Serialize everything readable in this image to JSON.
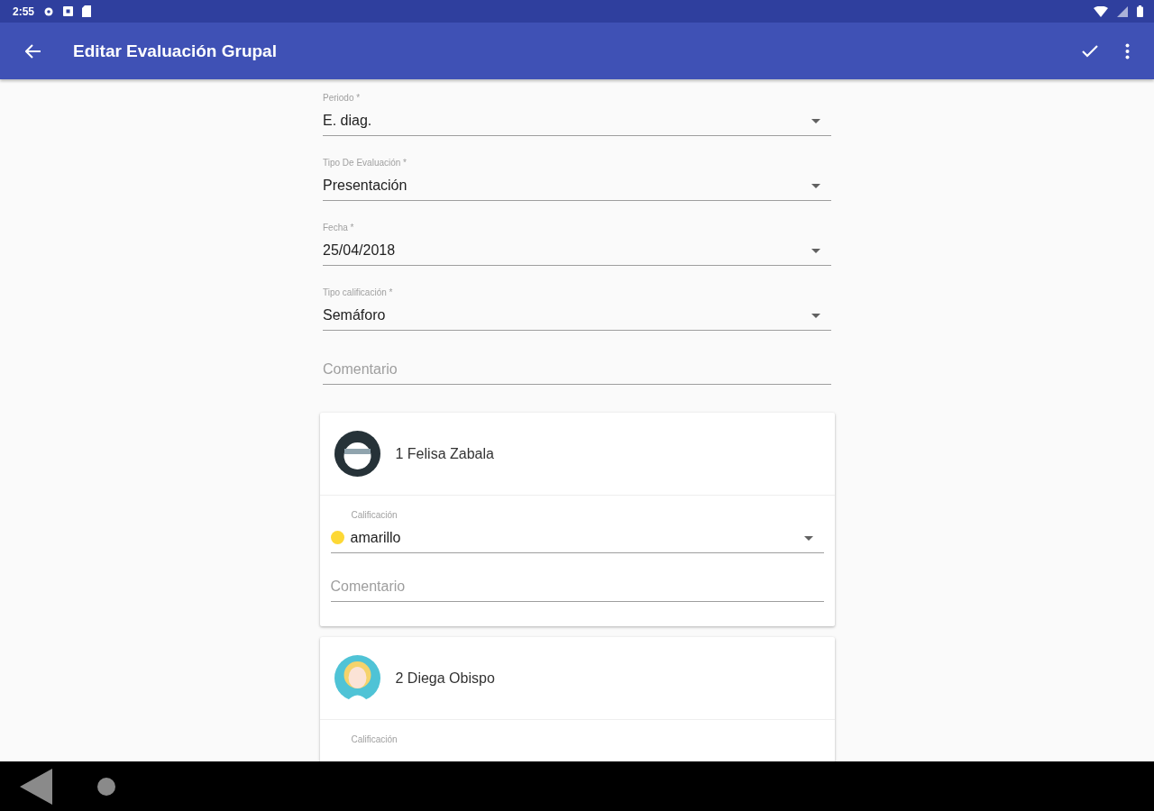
{
  "status_bar": {
    "time": "2:55"
  },
  "app_bar": {
    "title": "Editar Evaluación Grupal"
  },
  "fields": [
    {
      "kind": "dropdown",
      "label": "Periodo *",
      "value": "E. diag."
    },
    {
      "kind": "dropdown",
      "label": "Tipo De Evaluación *",
      "value": "Presentación"
    },
    {
      "kind": "dropdown",
      "label": "Fecha *",
      "value": "25/04/2018"
    },
    {
      "kind": "dropdown",
      "label": "Tipo calificación *",
      "value": "Semáforo"
    },
    {
      "kind": "text",
      "placeholder": "Comentario"
    }
  ],
  "students": [
    {
      "name": "1 Felisa Zabala",
      "grade_label": "Calificación",
      "grade": "amarillo",
      "color": "#fdd835",
      "comment_placeholder": "Comentario"
    },
    {
      "name": "2 Diega Obispo",
      "grade_label": "Calificación"
    }
  ]
}
